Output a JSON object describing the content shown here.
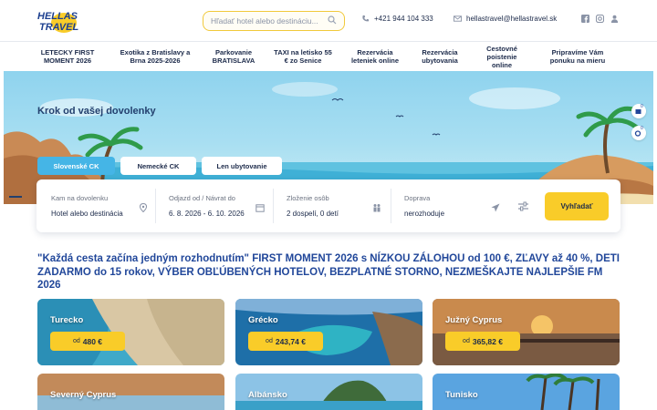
{
  "header": {
    "logo_text_line1": "HELLAS",
    "logo_text_line2": "TRAVEL",
    "search_placeholder": "Hľadať hotel alebo destináciu...",
    "phone": "+421 944 104 333",
    "email": "hellastravel@hellastravel.sk",
    "icons": [
      "facebook-icon",
      "instagram-icon",
      "user-icon"
    ]
  },
  "nav": {
    "items": [
      {
        "label": "LETECKY FIRST MOMENT 2026"
      },
      {
        "label": "Exotika z Bratislavy a Brna 2025-2026"
      },
      {
        "label": "Parkovanie BRATISLAVA"
      },
      {
        "label": "TAXI na letisko 55 € zo Senice"
      },
      {
        "label": "Rezervácia leteniek online"
      },
      {
        "label": "Rezervácia ubytovania"
      },
      {
        "label": "Cestovné poistenie online"
      },
      {
        "label": "Pripravíme Vám ponuku na mieru"
      }
    ]
  },
  "hero": {
    "title": "Krok od vašej dovolenky",
    "tabs": [
      "Slovenské CK",
      "Nemecké CK",
      "Len ubytovanie"
    ],
    "active_tab": "Slovenské CK",
    "side_counts": [
      "0",
      "0"
    ]
  },
  "search": {
    "destination": {
      "label": "Kam na dovolenku",
      "value": "Hotel alebo destinácia"
    },
    "dates": {
      "label": "Odjazd od / Návrat do",
      "value": "6. 8. 2026 - 6. 10. 2026"
    },
    "people": {
      "label": "Zloženie osôb",
      "value": "2 dospelí, 0 detí"
    },
    "transport": {
      "label": "Doprava",
      "value": "nerozhoduje"
    },
    "button": "Vyhľadať"
  },
  "promo_text": "\"Každá cesta začína jedným rozhodnutím\" FIRST MOMENT 2026 s NÍZKOU ZÁLOHOU od 100 €, ZĽAVY až 40 %, DETI ZADARMO do 15 rokov, VÝBER OBĽÚBENÝCH HOTELOV, BEZPLATNÉ STORNO, NEZMEŠKAJTE NAJLEPŠIE FM 2026",
  "destinations": [
    {
      "name": "Turecko",
      "price_prefix": "od",
      "price": "480 €"
    },
    {
      "name": "Grécko",
      "price_prefix": "od",
      "price": "243,74 €"
    },
    {
      "name": "Južný Cyprus",
      "price_prefix": "od",
      "price": "365,82 €"
    },
    {
      "name": "Severný Cyprus"
    },
    {
      "name": "Albánsko"
    },
    {
      "name": "Tunisko"
    }
  ],
  "colors": {
    "brand_blue": "#21479a",
    "accent_yellow": "#f9cc29",
    "tab_blue": "#45b5e6"
  }
}
